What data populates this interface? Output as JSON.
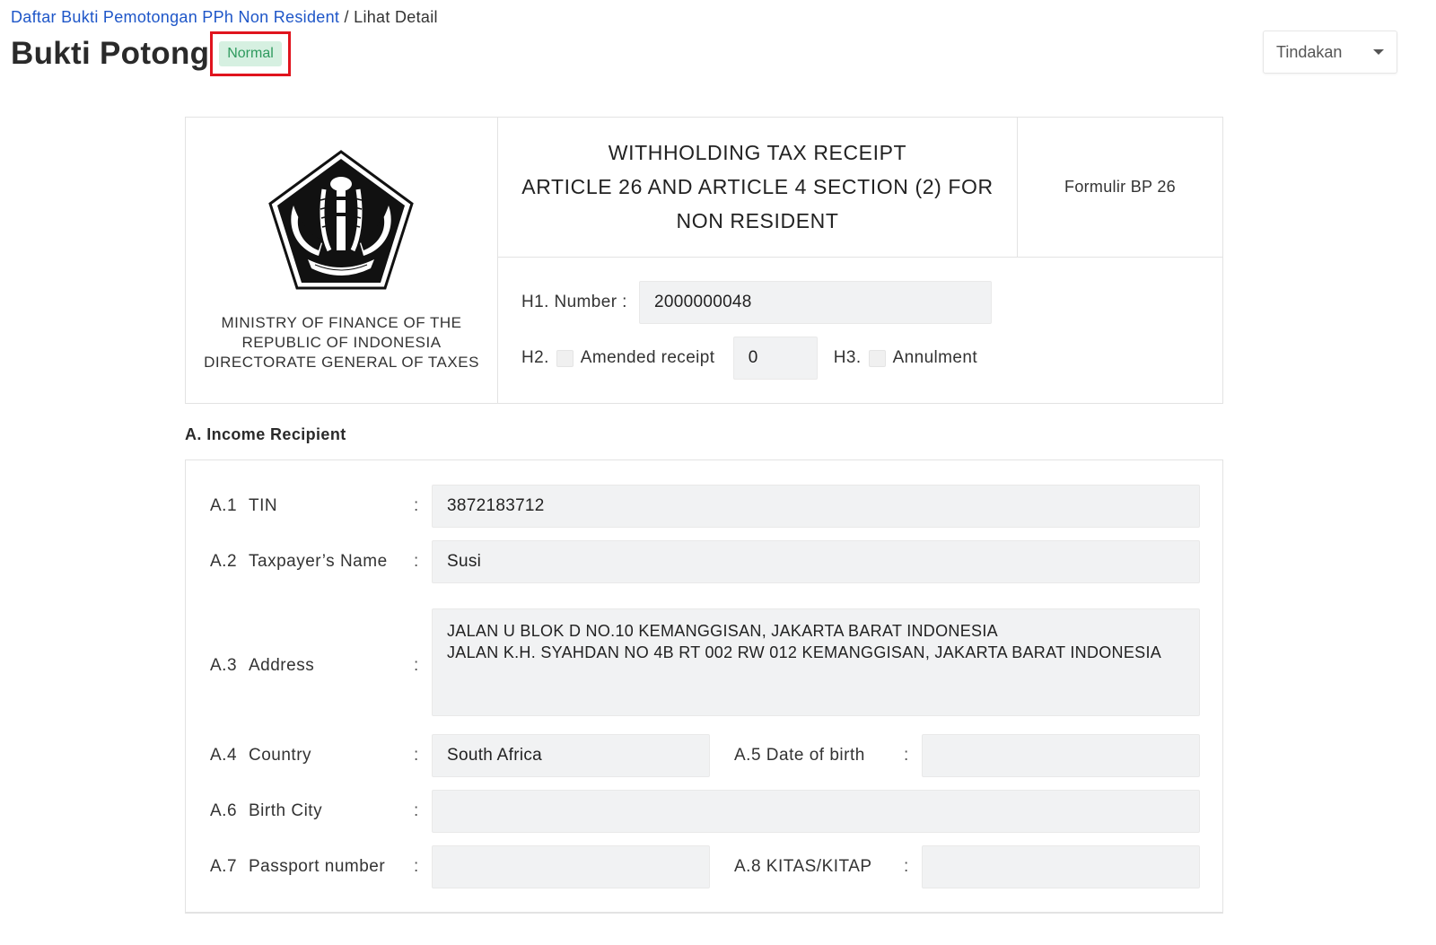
{
  "breadcrumb": {
    "parent": "Daftar Bukti Pemotongan PPh Non Resident",
    "separator": "/",
    "current": "Lihat Detail"
  },
  "page": {
    "title": "Bukti Potong",
    "status": "Normal",
    "actions_label": "Tindakan"
  },
  "header": {
    "ministry_lines": [
      "MINISTRY OF FINANCE OF THE",
      "REPUBLIC OF INDONESIA",
      "DIRECTORATE GENERAL OF TAXES"
    ],
    "title_lines": [
      "WITHHOLDING TAX RECEIPT",
      "ARTICLE 26 AND ARTICLE 4 SECTION (2) FOR",
      "NON RESIDENT"
    ],
    "form_code": "Formulir BP 26",
    "h1_label": "H1. Number :",
    "h1_value": "2000000048",
    "h2_label": "H2.",
    "h2_text": "Amended receipt",
    "h2_value": "0",
    "h3_label": "H3.",
    "h3_text": "Annulment"
  },
  "section_a": {
    "title": "A. Income Recipient",
    "colon": ":",
    "fields": {
      "a1": {
        "code": "A.1",
        "label": "TIN",
        "value": "3872183712"
      },
      "a2": {
        "code": "A.2",
        "label": "Taxpayer’s Name",
        "value": "Susi"
      },
      "a3": {
        "code": "A.3",
        "label": "Address",
        "lines": [
          "JALAN U BLOK D NO.10  KEMANGGISAN, JAKARTA BARAT  INDONESIA",
          "JALAN K.H. SYAHDAN NO 4B RT 002 RW 012  KEMANGGISAN, JAKARTA BARAT  INDONESIA"
        ]
      },
      "a4": {
        "code": "A.4",
        "label": "Country",
        "value": "South Africa"
      },
      "a5": {
        "label": "A.5 Date of birth",
        "value": ""
      },
      "a6": {
        "code": "A.6",
        "label": "Birth City",
        "value": ""
      },
      "a7": {
        "code": "A.7",
        "label": "Passport number",
        "value": ""
      },
      "a8": {
        "label": "A.8 KITAS/KITAP",
        "value": ""
      }
    }
  }
}
